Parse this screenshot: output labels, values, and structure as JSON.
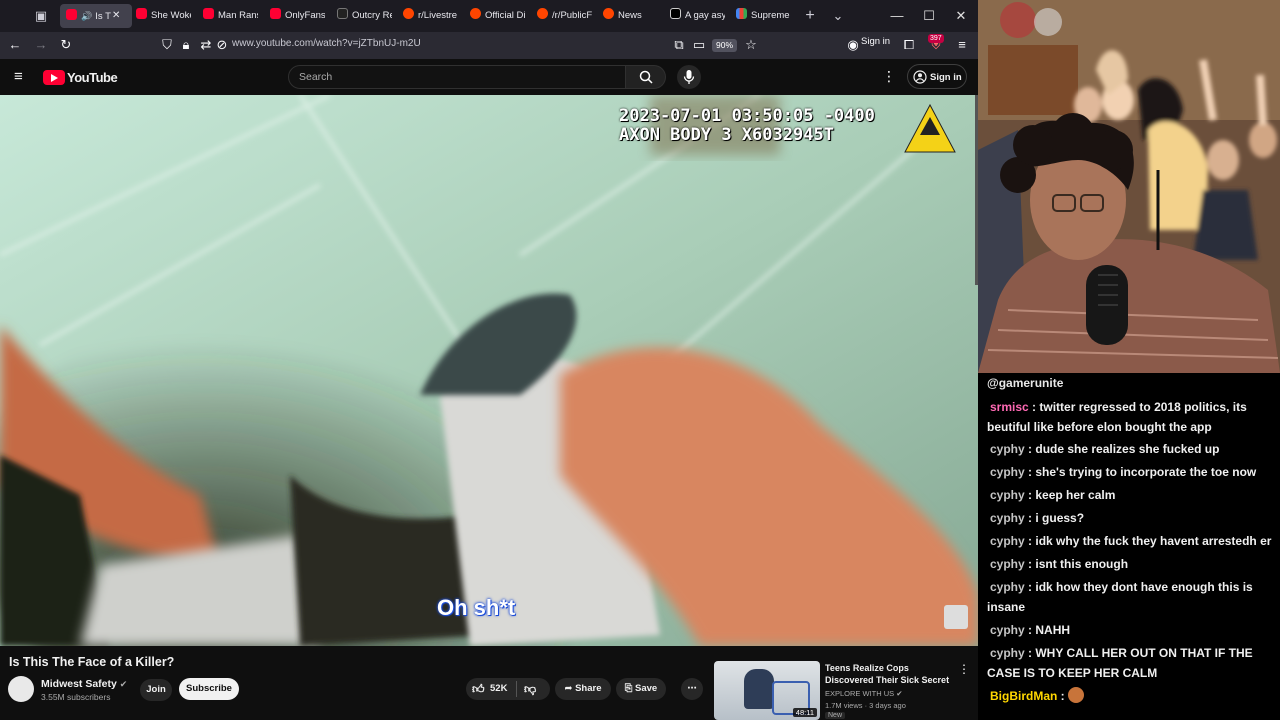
{
  "browser": {
    "tabs": [
      {
        "title": "Is T",
        "icon": "youtube",
        "active": true
      },
      {
        "title": "She Woke",
        "icon": "youtube"
      },
      {
        "title": "Man Rans",
        "icon": "youtube"
      },
      {
        "title": "OnlyFans",
        "icon": "youtube"
      },
      {
        "title": "Outcry Re",
        "icon": "x"
      },
      {
        "title": "r/Livestre",
        "icon": "reddit"
      },
      {
        "title": "Official Di",
        "icon": "reddit"
      },
      {
        "title": "/r/PublicF",
        "icon": "reddit"
      },
      {
        "title": "News",
        "icon": "reddit"
      },
      {
        "title": "A gay asy",
        "icon": "generic"
      },
      {
        "title": "Supreme",
        "icon": "google"
      }
    ],
    "url": "www.youtube.com/watch?v=jZTbnUJ-m2U",
    "zoom": "90%",
    "sign_in": "Sign in",
    "extension_badge": "397"
  },
  "youtube": {
    "logo_text": "YouTube",
    "search_placeholder": "Search",
    "sign_in": "Sign in",
    "video": {
      "timestamp_line1": "2023-07-01 03:50:05 -0400",
      "timestamp_line2": "AXON BODY 3 X6032945T",
      "subtitle": "Oh sh*t"
    },
    "title": "Is This The Face of a Killer?",
    "channel": {
      "name": "Midwest Safety",
      "subscribers": "3.55M subscribers",
      "verified": true
    },
    "join_label": "Join",
    "subscribe_label": "Subscribe",
    "like_count": "52K",
    "share_label": "Share",
    "save_label": "Save",
    "recommended": {
      "title": "Teens Realize Cops Discovered Their Sick Secret",
      "channel": "EXPLORE WITH US",
      "meta": "1.7M views · 3 days ago",
      "duration": "48:11",
      "badge": "New"
    }
  },
  "chat": {
    "header": "@gamerunite",
    "messages": [
      {
        "user": "srmisc",
        "color": "#ff69b4",
        "text": "twitter regressed to 2018 politics, its beutiful like before elon bought the app"
      },
      {
        "user": "cyphy",
        "color": "#c5c5c5",
        "text": "dude she realizes she fucked up"
      },
      {
        "user": "cyphy",
        "color": "#c5c5c5",
        "text": "she's trying to incorporate the toe now"
      },
      {
        "user": "cyphy",
        "color": "#c5c5c5",
        "text": "keep her calm"
      },
      {
        "user": "cyphy",
        "color": "#c5c5c5",
        "text": "i guess?"
      },
      {
        "user": "cyphy",
        "color": "#c5c5c5",
        "text": "idk why the fuck they havent arrestedh er"
      },
      {
        "user": "cyphy",
        "color": "#c5c5c5",
        "text": "isnt this enough"
      },
      {
        "user": "cyphy",
        "color": "#c5c5c5",
        "text": "idk how they dont have enough this is insane"
      },
      {
        "user": "cyphy",
        "color": "#c5c5c5",
        "text": "NAHH"
      },
      {
        "user": "cyphy",
        "color": "#c5c5c5",
        "text": "WHY CALL HER OUT ON THAT IF THE CASE IS TO KEEP HER CALM"
      },
      {
        "user": "BigBirdMan",
        "color": "#ffd700",
        "text": ""
      }
    ]
  }
}
